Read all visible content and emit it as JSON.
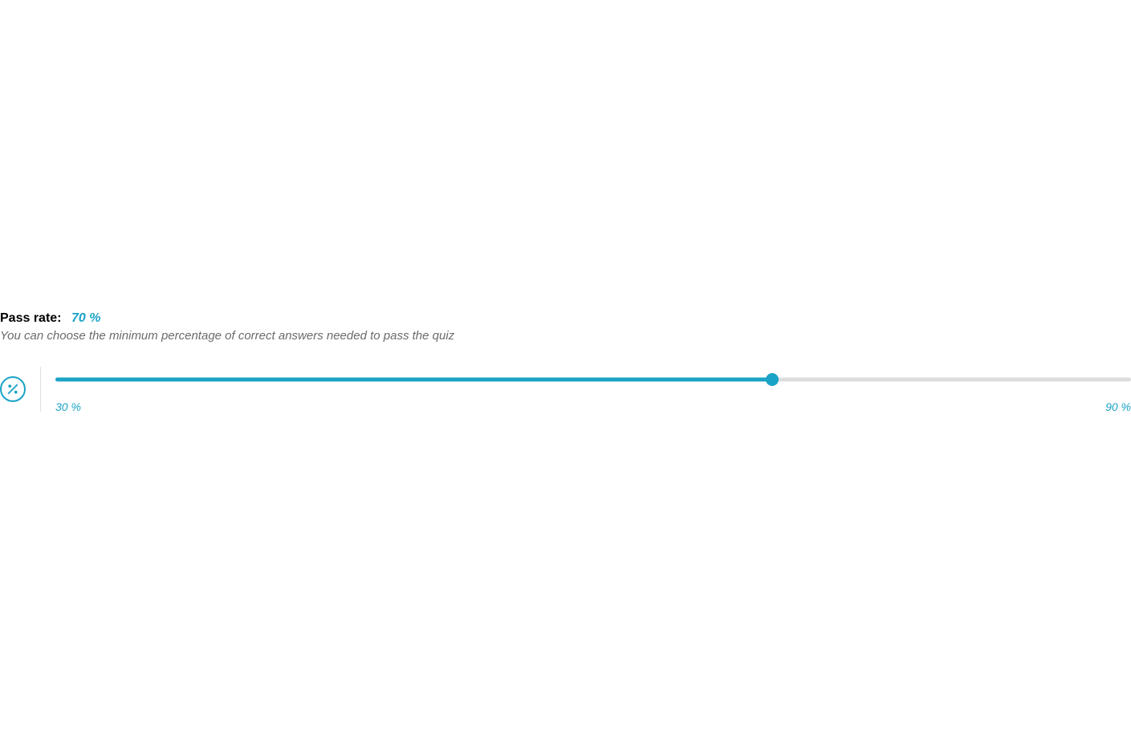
{
  "passRate": {
    "label": "Pass rate:",
    "value": "70 %",
    "description": "You can choose the minimum percentage of correct answers needed to pass the quiz",
    "slider": {
      "min": 30,
      "max": 90,
      "current": 70,
      "minLabel": "30 %",
      "maxLabel": "90 %",
      "fillPercent": "66.67%",
      "handlePercent": "66.67%"
    },
    "iconName": "percent-icon"
  },
  "colors": {
    "accent": "#1ba3c6",
    "textMuted": "#6b6b6b",
    "trackBg": "#dcdcdc"
  }
}
